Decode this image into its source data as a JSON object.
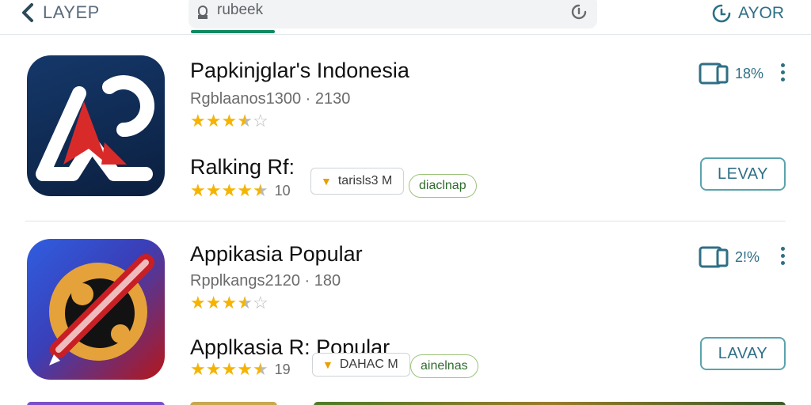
{
  "topbar": {
    "back_label": "LAYEP",
    "search_text": "rubeek",
    "right_label": "AYOR"
  },
  "apps": [
    {
      "name": "Papkinjglar's Indonesia",
      "meta": "Rgblaanos1300 · 2130",
      "rating_stars": 3.5,
      "subtitle": "Ralking Rf:",
      "sub_rating_stars": 4.5,
      "sub_rating_count": "10",
      "size_label": "tarisls3 M",
      "tag_label": "diaclnap",
      "device_percent": "18%",
      "install_label": "LEVAY"
    },
    {
      "name": "Appikasia Popular",
      "meta": "Rpplkangs2120 · 180",
      "rating_stars": 3.5,
      "subtitle": "Applkasia R: Popular",
      "sub_rating_stars": 4.5,
      "sub_rating_count": "19",
      "size_label": "DAHAC M",
      "tag_label": "ainelnas",
      "device_percent": "2!%",
      "install_label": "LAVAY"
    }
  ],
  "colors": {
    "accent": "#2f6f86",
    "star": "#f5b400",
    "search_underline": "#0f8a5f",
    "tag_border": "#9cc37a",
    "app1_bg": "#0e2a4f",
    "app1_red": "#d92a2a",
    "app2_bg": "#2a4fc9",
    "app2_orange": "#e5a23a"
  },
  "icons": {
    "back": "chevron-left-icon",
    "search": "search-icon",
    "mic": "mic-icon",
    "right_nav": "clock-icon",
    "device": "device-icon",
    "more": "more-vertical-icon",
    "download": "download-icon"
  }
}
